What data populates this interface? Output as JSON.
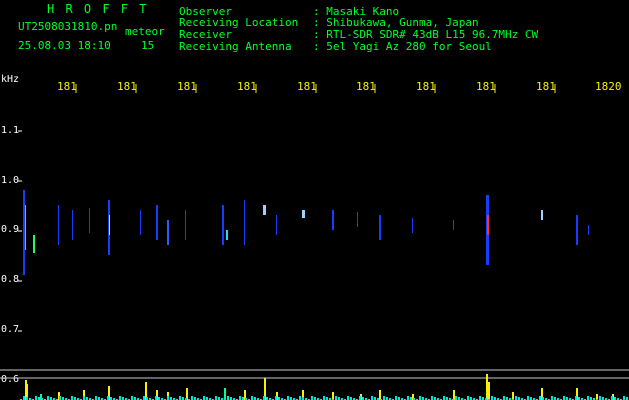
{
  "app": {
    "title": "H R O F F T"
  },
  "file": {
    "name": "UT2508031810.pn",
    "type": "meteor",
    "timestamp": "25.08.03 18:10",
    "count": "15"
  },
  "info": [
    {
      "label": "Observer",
      "value": ": Masaki Kano"
    },
    {
      "label": "Receiving Location",
      "value": ": Shibukawa, Gunma, Japan"
    },
    {
      "label": "Receiver",
      "value": ": RTL-SDR SDR# 43dB L15 96.7MHz CW"
    },
    {
      "label": "Receiving Antenna",
      "value": ": 5el Yagi Az 280 for Seoul"
    }
  ],
  "axis": {
    "unit": "kHz",
    "y_ticks": [
      "1.1",
      "1.0",
      "0.9",
      "0.8",
      "0.7",
      "0.6"
    ],
    "x_ticks": [
      "181",
      "181",
      "181",
      "181",
      "181",
      "181",
      "181",
      "181",
      "181",
      "1820"
    ]
  },
  "colors": {
    "bg": "#000000",
    "text": "#00ff2a",
    "ticks": "#f6f100",
    "grid": "#c8c8c8"
  }
}
